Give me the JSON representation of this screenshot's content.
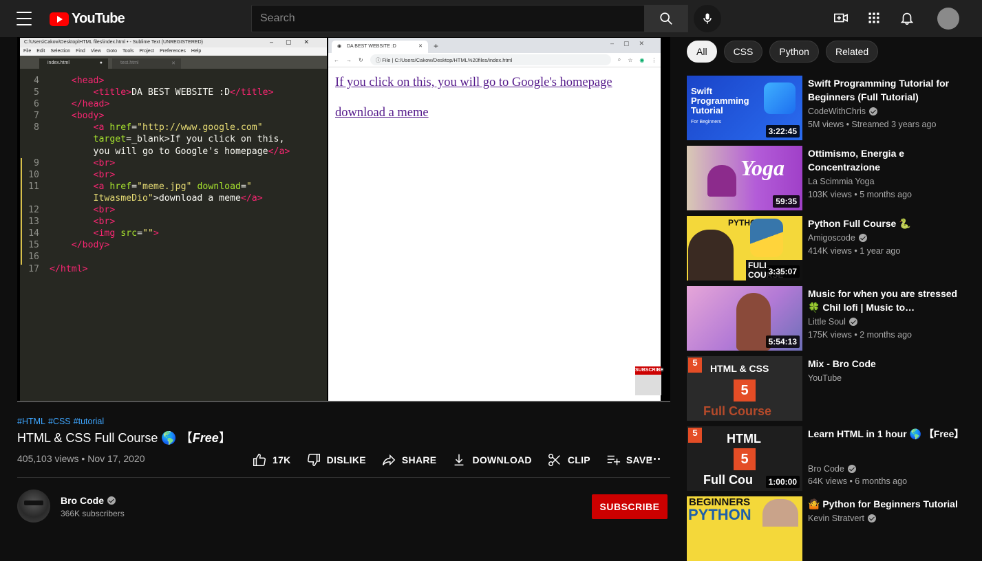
{
  "header": {
    "logo_text": "YouTube",
    "search_placeholder": "Search"
  },
  "editor": {
    "window_title": "C:\\Users\\Cakow\\Desktop\\HTML files\\index.html • - Sublime Text (UNREGISTERED)",
    "menu": [
      "File",
      "Edit",
      "Selection",
      "Find",
      "View",
      "Goto",
      "Tools",
      "Project",
      "Preferences",
      "Help"
    ],
    "tabs": [
      "index.html",
      "test.html"
    ],
    "lines": [
      {
        "n": "4",
        "parts": [
          [
            "",
            "    "
          ],
          [
            "tag",
            "<head>"
          ]
        ]
      },
      {
        "n": "5",
        "parts": [
          [
            "",
            "        "
          ],
          [
            "tag",
            "<title>"
          ],
          [
            "",
            "DA BEST WEBSITE :D"
          ],
          [
            "tag",
            "</title>"
          ]
        ]
      },
      {
        "n": "6",
        "parts": [
          [
            "",
            "    "
          ],
          [
            "tag",
            "</head>"
          ]
        ]
      },
      {
        "n": "7",
        "parts": [
          [
            "",
            "    "
          ],
          [
            "tag",
            "<body>"
          ]
        ]
      },
      {
        "n": "8",
        "parts": [
          [
            "",
            "        "
          ],
          [
            "tag",
            "<a "
          ],
          [
            "attr",
            "href"
          ],
          [
            "",
            "="
          ],
          [
            "str",
            "\"http://www.google.com\""
          ]
        ]
      },
      {
        "n": "",
        "parts": [
          [
            "",
            "        "
          ],
          [
            "attr",
            "target"
          ],
          [
            "",
            "=_blank>If you click on this,"
          ]
        ]
      },
      {
        "n": "",
        "parts": [
          [
            "",
            "        you will go to Google's homepage"
          ],
          [
            "tag",
            "</a>"
          ]
        ]
      },
      {
        "n": "9",
        "parts": [
          [
            "",
            "        "
          ],
          [
            "tag",
            "<br>"
          ]
        ]
      },
      {
        "n": "10",
        "parts": [
          [
            "",
            "        "
          ],
          [
            "tag",
            "<br>"
          ]
        ]
      },
      {
        "n": "11",
        "parts": [
          [
            "",
            "        "
          ],
          [
            "tag",
            "<a "
          ],
          [
            "attr",
            "href"
          ],
          [
            "",
            "="
          ],
          [
            "str",
            "\"meme.jpg\""
          ],
          [
            "",
            " "
          ],
          [
            "attr",
            "download"
          ],
          [
            "",
            "="
          ],
          [
            "str",
            "\""
          ]
        ]
      },
      {
        "n": "",
        "parts": [
          [
            "",
            "        "
          ],
          [
            "str",
            "ItwasmeDio\""
          ],
          [
            "",
            ">download a meme"
          ],
          [
            "tag",
            "</a>"
          ]
        ]
      },
      {
        "n": "12",
        "parts": [
          [
            "",
            "        "
          ],
          [
            "tag",
            "<br>"
          ]
        ]
      },
      {
        "n": "13",
        "parts": [
          [
            "",
            "        "
          ],
          [
            "tag",
            "<br>"
          ]
        ]
      },
      {
        "n": "14",
        "parts": [
          [
            "",
            "        "
          ],
          [
            "tag",
            "<img "
          ],
          [
            "attr",
            "src"
          ],
          [
            "",
            "="
          ],
          [
            "str",
            "\"\""
          ],
          [
            "tag",
            ">"
          ]
        ]
      },
      {
        "n": "15",
        "parts": [
          [
            "",
            "    "
          ],
          [
            "tag",
            "</body>"
          ]
        ]
      },
      {
        "n": "16",
        "parts": [
          [
            "",
            ""
          ]
        ]
      },
      {
        "n": "17",
        "parts": [
          [
            "tag",
            "</html>"
          ]
        ]
      }
    ]
  },
  "browser": {
    "tab_title": "DA BEST WEBSITE :D",
    "url_label": "File",
    "url": "C:/Users/Cakow/Desktop/HTML%20files/index.html",
    "link1": "If you click on this, you will go to Google's homepage",
    "link2": "download a meme"
  },
  "video": {
    "hashtags": [
      "#HTML",
      "#CSS",
      "#tutorial"
    ],
    "title": "HTML & CSS Full Course 🌎 【",
    "title_italic": "Free",
    "title_end": "】",
    "views": "405,103 views",
    "date": "Nov 17, 2020",
    "likes": "17K",
    "dislike_label": "DISLIKE",
    "share_label": "SHARE",
    "download_label": "DOWNLOAD",
    "clip_label": "CLIP",
    "save_label": "SAVE"
  },
  "channel": {
    "name": "Bro Code",
    "subscribers": "366K subscribers",
    "subscribe_label": "SUBSCRIBE"
  },
  "chips": [
    "All",
    "CSS",
    "Python",
    "Related"
  ],
  "recommendations": [
    {
      "title": "Swift Programming Tutorial for Beginners (Full Tutorial)",
      "channel": "CodeWithChris",
      "verified": true,
      "meta": "5M views • Streamed 3 years ago",
      "duration": "3:22:45"
    },
    {
      "title": "Ottimismo, Energia e Concentrazione",
      "channel": "La Scimmia Yoga",
      "verified": false,
      "meta": "103K views • 5 months ago",
      "duration": "59:35"
    },
    {
      "title": "Python Full Course 🐍",
      "channel": "Amigoscode",
      "verified": true,
      "meta": "414K views • 1 year ago",
      "duration": "3:35:07"
    },
    {
      "title": "Music for when you are stressed 🍀 Chil lofi | Music to…",
      "channel": "Little Soul",
      "verified": true,
      "meta": "175K views • 2 months ago",
      "duration": "5:54:13"
    },
    {
      "title": "Mix - Bro Code",
      "channel": "YouTube",
      "verified": false,
      "meta": "",
      "duration": ""
    },
    {
      "title": "Learn HTML in 1 hour 🌎 【Free】",
      "channel": "Bro Code",
      "verified": true,
      "meta": "64K views • 6 months ago",
      "duration": "1:00:00"
    },
    {
      "title": "🤷 Python for Beginners Tutorial",
      "channel": "Kevin Stratvert",
      "verified": true,
      "meta": "",
      "duration": ""
    }
  ],
  "thumb_text": {
    "swift": [
      "Swift",
      "Programming",
      "Tutorial",
      "For Beginners"
    ],
    "yoga": "Yoga",
    "python": "PYTHON",
    "python_full": "FULL COURSE",
    "html_css": "HTML & CSS",
    "full_course": "Full Course",
    "html": "HTML",
    "full_cou": "Full Cou",
    "beginners": "BEGINNERS",
    "python2": "PYTHON"
  }
}
